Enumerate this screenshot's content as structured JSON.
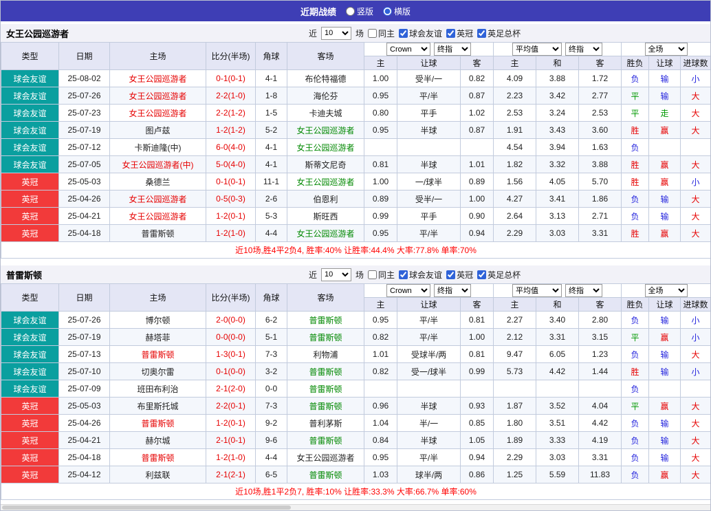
{
  "topbar": {
    "title": "近期战绩",
    "view_options": [
      {
        "label": "竖版",
        "selected": false
      },
      {
        "label": "横版",
        "selected": true
      }
    ]
  },
  "filter": {
    "near_label": "近",
    "count": "10",
    "games_label": "场",
    "same_home_label": "同主",
    "same_home_checked": false,
    "leagues": [
      {
        "label": "球会友谊",
        "checked": true
      },
      {
        "label": "英冠",
        "checked": true
      },
      {
        "label": "英足总杯",
        "checked": true
      }
    ]
  },
  "controls": {
    "bookmaker": "Crown",
    "final_odds": "终指",
    "average": "平均值",
    "full_match": "全场"
  },
  "col_headers": {
    "type": "类型",
    "date": "日期",
    "home": "主场",
    "score": "比分(半场)",
    "corner": "角球",
    "away": "客场",
    "sub": [
      "主",
      "让球",
      "客",
      "主",
      "和",
      "客",
      "胜负",
      "让球",
      "进球数"
    ]
  },
  "colors": {
    "topbar_bg": "#3e3eb5",
    "friendly": "#0a9f9f",
    "championship": "#f23a3a",
    "win_red": "#e60000",
    "draw_green": "#009900",
    "loss_blue": "#2323dd",
    "focal_home": "#e60000",
    "focal_away": "#008800"
  },
  "sections": [
    {
      "team": "女王公园巡游者",
      "summary": "近10场,胜4平2负4, 胜率:40% 让胜率:44.4% 大率:77.8% 单率:70%",
      "rows": [
        {
          "league": "球会友谊",
          "date": "25-08-02",
          "home": "女王公园巡游者",
          "home_focal": true,
          "score": "0-1(0-1)",
          "corner": "4-1",
          "away": "布伦特福德",
          "away_focal": false,
          "odds": [
            "1.00",
            "受半/一",
            "0.82"
          ],
          "avg": [
            "4.09",
            "3.88",
            "1.72"
          ],
          "result": "负",
          "handicap_result": "输",
          "goals_result": "小"
        },
        {
          "league": "球会友谊",
          "date": "25-07-26",
          "home": "女王公园巡游者",
          "home_focal": true,
          "score": "2-2(1-0)",
          "corner": "1-8",
          "away": "海伦芬",
          "away_focal": false,
          "odds": [
            "0.95",
            "平/半",
            "0.87"
          ],
          "avg": [
            "2.23",
            "3.42",
            "2.77"
          ],
          "result": "平",
          "handicap_result": "输",
          "goals_result": "大"
        },
        {
          "league": "球会友谊",
          "date": "25-07-23",
          "home": "女王公园巡游者",
          "home_focal": true,
          "score": "2-2(1-2)",
          "corner": "1-5",
          "away": "卡迪夫城",
          "away_focal": false,
          "odds": [
            "0.80",
            "平手",
            "1.02"
          ],
          "avg": [
            "2.53",
            "3.24",
            "2.53"
          ],
          "result": "平",
          "handicap_result": "走",
          "goals_result": "大"
        },
        {
          "league": "球会友谊",
          "date": "25-07-19",
          "home": "图卢兹",
          "home_focal": false,
          "score": "1-2(1-2)",
          "corner": "5-2",
          "away": "女王公园巡游者",
          "away_focal": true,
          "odds": [
            "0.95",
            "半球",
            "0.87"
          ],
          "avg": [
            "1.91",
            "3.43",
            "3.60"
          ],
          "result": "胜",
          "handicap_result": "赢",
          "goals_result": "大"
        },
        {
          "league": "球会友谊",
          "date": "25-07-12",
          "home": "卡斯迪隆(中)",
          "home_focal": false,
          "score": "6-0(4-0)",
          "corner": "4-1",
          "away": "女王公园巡游者",
          "away_focal": true,
          "odds": [
            "",
            "",
            ""
          ],
          "avg": [
            "4.54",
            "3.94",
            "1.63"
          ],
          "result": "负",
          "handicap_result": "",
          "goals_result": ""
        },
        {
          "league": "球会友谊",
          "date": "25-07-05",
          "home": "女王公园巡游者(中)",
          "home_focal": true,
          "score": "5-0(4-0)",
          "corner": "4-1",
          "away": "斯蒂文尼奇",
          "away_focal": false,
          "odds": [
            "0.81",
            "半球",
            "1.01"
          ],
          "avg": [
            "1.82",
            "3.32",
            "3.88"
          ],
          "result": "胜",
          "handicap_result": "赢",
          "goals_result": "大"
        },
        {
          "league": "英冠",
          "date": "25-05-03",
          "home": "桑德兰",
          "home_focal": false,
          "score": "0-1(0-1)",
          "corner": "11-1",
          "away": "女王公园巡游者",
          "away_focal": true,
          "odds": [
            "1.00",
            "一/球半",
            "0.89"
          ],
          "avg": [
            "1.56",
            "4.05",
            "5.70"
          ],
          "result": "胜",
          "handicap_result": "赢",
          "goals_result": "小"
        },
        {
          "league": "英冠",
          "date": "25-04-26",
          "home": "女王公园巡游者",
          "home_focal": true,
          "score": "0-5(0-3)",
          "corner": "2-6",
          "away": "伯恩利",
          "away_focal": false,
          "odds": [
            "0.89",
            "受半/一",
            "1.00"
          ],
          "avg": [
            "4.27",
            "3.41",
            "1.86"
          ],
          "result": "负",
          "handicap_result": "输",
          "goals_result": "大"
        },
        {
          "league": "英冠",
          "date": "25-04-21",
          "home": "女王公园巡游者",
          "home_focal": true,
          "score": "1-2(0-1)",
          "corner": "5-3",
          "away": "斯旺西",
          "away_focal": false,
          "odds": [
            "0.99",
            "平手",
            "0.90"
          ],
          "avg": [
            "2.64",
            "3.13",
            "2.71"
          ],
          "result": "负",
          "handicap_result": "输",
          "goals_result": "大"
        },
        {
          "league": "英冠",
          "date": "25-04-18",
          "home": "普雷斯顿",
          "home_focal": false,
          "score": "1-2(1-0)",
          "corner": "4-4",
          "away": "女王公园巡游者",
          "away_focal": true,
          "odds": [
            "0.95",
            "平/半",
            "0.94"
          ],
          "avg": [
            "2.29",
            "3.03",
            "3.31"
          ],
          "result": "胜",
          "handicap_result": "赢",
          "goals_result": "大"
        }
      ]
    },
    {
      "team": "普雷斯顿",
      "summary": "近10场,胜1平2负7, 胜率:10% 让胜率:33.3% 大率:66.7% 单率:60%",
      "rows": [
        {
          "league": "球会友谊",
          "date": "25-07-26",
          "home": "博尔顿",
          "home_focal": false,
          "score": "2-0(0-0)",
          "corner": "6-2",
          "away": "普雷斯顿",
          "away_focal": true,
          "odds": [
            "0.95",
            "平/半",
            "0.81"
          ],
          "avg": [
            "2.27",
            "3.40",
            "2.80"
          ],
          "result": "负",
          "handicap_result": "输",
          "goals_result": "小"
        },
        {
          "league": "球会友谊",
          "date": "25-07-19",
          "home": "赫塔菲",
          "home_focal": false,
          "score": "0-0(0-0)",
          "corner": "5-1",
          "away": "普雷斯顿",
          "away_focal": true,
          "odds": [
            "0.82",
            "平/半",
            "1.00"
          ],
          "avg": [
            "2.12",
            "3.31",
            "3.15"
          ],
          "result": "平",
          "handicap_result": "赢",
          "goals_result": "小"
        },
        {
          "league": "球会友谊",
          "date": "25-07-13",
          "home": "普雷斯顿",
          "home_focal": true,
          "score": "1-3(0-1)",
          "corner": "7-3",
          "away": "利物浦",
          "away_focal": false,
          "odds": [
            "1.01",
            "受球半/两",
            "0.81"
          ],
          "avg": [
            "9.47",
            "6.05",
            "1.23"
          ],
          "result": "负",
          "handicap_result": "输",
          "goals_result": "大"
        },
        {
          "league": "球会友谊",
          "date": "25-07-10",
          "home": "切奥尔雷",
          "home_focal": false,
          "score": "0-1(0-0)",
          "corner": "3-2",
          "away": "普雷斯顿",
          "away_focal": true,
          "odds": [
            "0.82",
            "受一/球半",
            "0.99"
          ],
          "avg": [
            "5.73",
            "4.42",
            "1.44"
          ],
          "result": "胜",
          "handicap_result": "输",
          "goals_result": "小"
        },
        {
          "league": "球会友谊",
          "date": "25-07-09",
          "home": "班田布利治",
          "home_focal": false,
          "score": "2-1(2-0)",
          "corner": "0-0",
          "away": "普雷斯顿",
          "away_focal": true,
          "odds": [
            "",
            "",
            ""
          ],
          "avg": [
            "",
            "",
            ""
          ],
          "result": "负",
          "handicap_result": "",
          "goals_result": ""
        },
        {
          "league": "英冠",
          "date": "25-05-03",
          "home": "布里斯托城",
          "home_focal": false,
          "score": "2-2(0-1)",
          "corner": "7-3",
          "away": "普雷斯顿",
          "away_focal": true,
          "odds": [
            "0.96",
            "半球",
            "0.93"
          ],
          "avg": [
            "1.87",
            "3.52",
            "4.04"
          ],
          "result": "平",
          "handicap_result": "赢",
          "goals_result": "大"
        },
        {
          "league": "英冠",
          "date": "25-04-26",
          "home": "普雷斯顿",
          "home_focal": true,
          "score": "1-2(0-1)",
          "corner": "9-2",
          "away": "普利茅斯",
          "away_focal": false,
          "odds": [
            "1.04",
            "半/一",
            "0.85"
          ],
          "avg": [
            "1.80",
            "3.51",
            "4.42"
          ],
          "result": "负",
          "handicap_result": "输",
          "goals_result": "大"
        },
        {
          "league": "英冠",
          "date": "25-04-21",
          "home": "赫尔城",
          "home_focal": false,
          "score": "2-1(0-1)",
          "corner": "9-6",
          "away": "普雷斯顿",
          "away_focal": true,
          "odds": [
            "0.84",
            "半球",
            "1.05"
          ],
          "avg": [
            "1.89",
            "3.33",
            "4.19"
          ],
          "result": "负",
          "handicap_result": "输",
          "goals_result": "大"
        },
        {
          "league": "英冠",
          "date": "25-04-18",
          "home": "普雷斯顿",
          "home_focal": true,
          "score": "1-2(1-0)",
          "corner": "4-4",
          "away": "女王公园巡游者",
          "away_focal": false,
          "odds": [
            "0.95",
            "平/半",
            "0.94"
          ],
          "avg": [
            "2.29",
            "3.03",
            "3.31"
          ],
          "result": "负",
          "handicap_result": "输",
          "goals_result": "大"
        },
        {
          "league": "英冠",
          "date": "25-04-12",
          "home": "利兹联",
          "home_focal": false,
          "score": "2-1(2-1)",
          "corner": "6-5",
          "away": "普雷斯顿",
          "away_focal": true,
          "odds": [
            "1.03",
            "球半/两",
            "0.86"
          ],
          "avg": [
            "1.25",
            "5.59",
            "11.83"
          ],
          "result": "负",
          "handicap_result": "赢",
          "goals_result": "大"
        }
      ]
    }
  ]
}
